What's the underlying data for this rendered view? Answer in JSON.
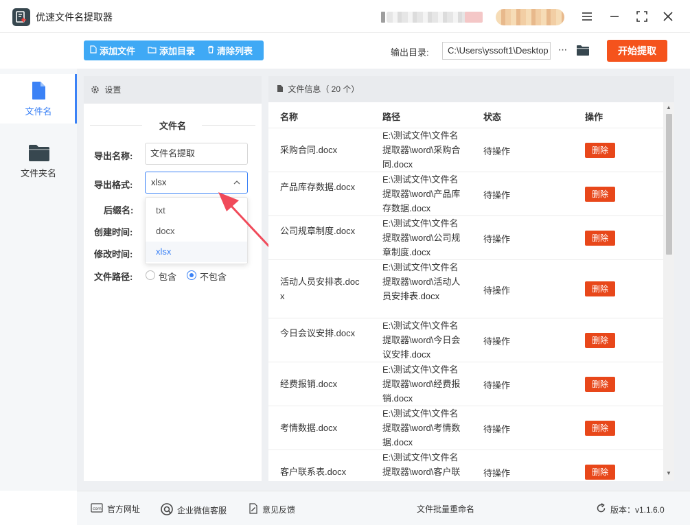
{
  "app": {
    "title": "优速文件名提取器"
  },
  "window": {
    "menu_icon": "menu-icon",
    "min_icon": "minimize-icon",
    "max_icon": "maximize-icon",
    "close_icon": "close-icon"
  },
  "toolbar": {
    "add_file": "添加文件",
    "add_dir": "添加目录",
    "clear_list": "清除列表",
    "output_label": "输出目录:",
    "output_value": "C:\\Users\\yssoft1\\Desktop",
    "more": "···",
    "start": "开始提取"
  },
  "nav": [
    {
      "label": "文件名",
      "icon": "file-icon",
      "active": true
    },
    {
      "label": "文件夹名",
      "icon": "folder-icon",
      "active": false
    }
  ],
  "settings": {
    "header": "设置",
    "section_title": "文件名",
    "export_name_label": "导出名称:",
    "export_name_value": "文件名提取",
    "export_format_label": "导出格式:",
    "export_format_value": "xlsx",
    "format_options": [
      "txt",
      "docx",
      "xlsx"
    ],
    "selected_format": "xlsx",
    "suffix_label": "后缀名:",
    "created_label": "创建时间:",
    "modified_label": "修改时间:",
    "path_label": "文件路径:",
    "path_include": "包含",
    "path_exclude": "不包含",
    "path_selected": "不包含"
  },
  "fileinfo": {
    "header": "文件信息（ 20 个）",
    "columns": {
      "name": "名称",
      "path": "路径",
      "status": "状态",
      "action": "操作"
    },
    "rows": [
      {
        "name": "采购合同.docx",
        "path": "E:\\测试文件\\文件名提取器\\word\\采购合同.docx",
        "status": "待操作",
        "action": "删除"
      },
      {
        "name": "产品库存数据.docx",
        "path": "E:\\测试文件\\文件名提取器\\word\\产品库存数据.docx",
        "status": "待操作",
        "action": "删除"
      },
      {
        "name": "公司规章制度.docx",
        "path": "E:\\测试文件\\文件名提取器\\word\\公司规章制度.docx",
        "status": "待操作",
        "action": "删除"
      },
      {
        "name": "活动人员安排表.docx",
        "path": "E:\\测试文件\\文件名提取器\\word\\活动人员安排表.docx",
        "status": "待操作",
        "action": "删除"
      },
      {
        "name": "今日会议安排.docx",
        "path": "E:\\测试文件\\文件名提取器\\word\\今日会议安排.docx",
        "status": "待操作",
        "action": "删除"
      },
      {
        "name": "经费报销.docx",
        "path": "E:\\测试文件\\文件名提取器\\word\\经费报销.docx",
        "status": "待操作",
        "action": "删除"
      },
      {
        "name": "考情数据.docx",
        "path": "E:\\测试文件\\文件名提取器\\word\\考情数据.docx",
        "status": "待操作",
        "action": "删除"
      },
      {
        "name": "客户联系表.docx",
        "path": "E:\\测试文件\\文件名提取器\\word\\客户联系表.docx",
        "status": "待操作",
        "action": "删除"
      }
    ]
  },
  "footer": {
    "website": "官方网址",
    "wechat": "企业微信客服",
    "feedback": "意见反馈",
    "rename": "文件批量重命名",
    "version": "版本：v1.1.6.0"
  },
  "colors": {
    "accent": "#3fa9f5",
    "start": "#f5531c",
    "delete": "#e8471a",
    "select_border": "#3b82f6"
  }
}
